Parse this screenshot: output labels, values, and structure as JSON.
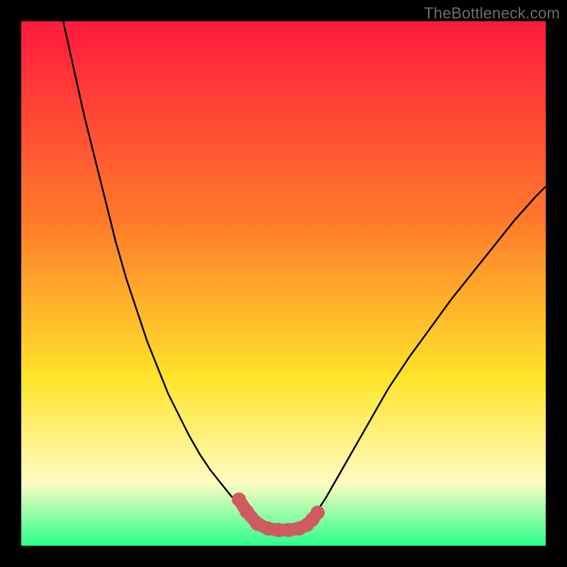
{
  "watermark": "TheBottleneck.com",
  "colors": {
    "frame": "#000000",
    "gradient_top": "#ff1a3e",
    "gradient_mid1": "#ff7a2a",
    "gradient_mid2": "#ffe42a",
    "gradient_low": "#fffbc2",
    "gradient_bottom": "#2aff8a",
    "curve": "#000000",
    "marker_fill": "#cf5b62",
    "marker_stroke": "#cf5b62"
  },
  "chart_data": {
    "type": "line",
    "title": "",
    "xlabel": "",
    "ylabel": "",
    "xlim": [
      0,
      100
    ],
    "ylim": [
      0,
      100
    ],
    "series": [
      {
        "name": "bottleneck-curve",
        "x": [
          8,
          10,
          12,
          14,
          16,
          18,
          20,
          22,
          24,
          26,
          28,
          30,
          32,
          34,
          36,
          38,
          40,
          42,
          44,
          46,
          48,
          50,
          52,
          54,
          56,
          58,
          60,
          62,
          64,
          66,
          68,
          70,
          74,
          78,
          82,
          86,
          90,
          94,
          98,
          100
        ],
        "y": [
          100,
          91,
          82,
          74,
          66,
          58,
          51,
          45,
          39,
          34,
          29,
          25,
          21,
          17.5,
          14.5,
          12,
          9.5,
          7.5,
          5.5,
          4,
          3.2,
          3,
          3.2,
          4,
          6,
          9,
          12.5,
          16,
          19.5,
          23,
          26.5,
          30,
          36,
          41.5,
          47,
          52,
          57,
          62,
          66.5,
          68.5
        ]
      }
    ],
    "markers": {
      "name": "plateau-points",
      "x": [
        41.5,
        43,
        45,
        47,
        49,
        51,
        53,
        54.5,
        55.5,
        56.5
      ],
      "y": [
        8.8,
        6.5,
        4.2,
        3.3,
        3,
        3,
        3.3,
        4,
        5,
        6.3
      ]
    }
  }
}
